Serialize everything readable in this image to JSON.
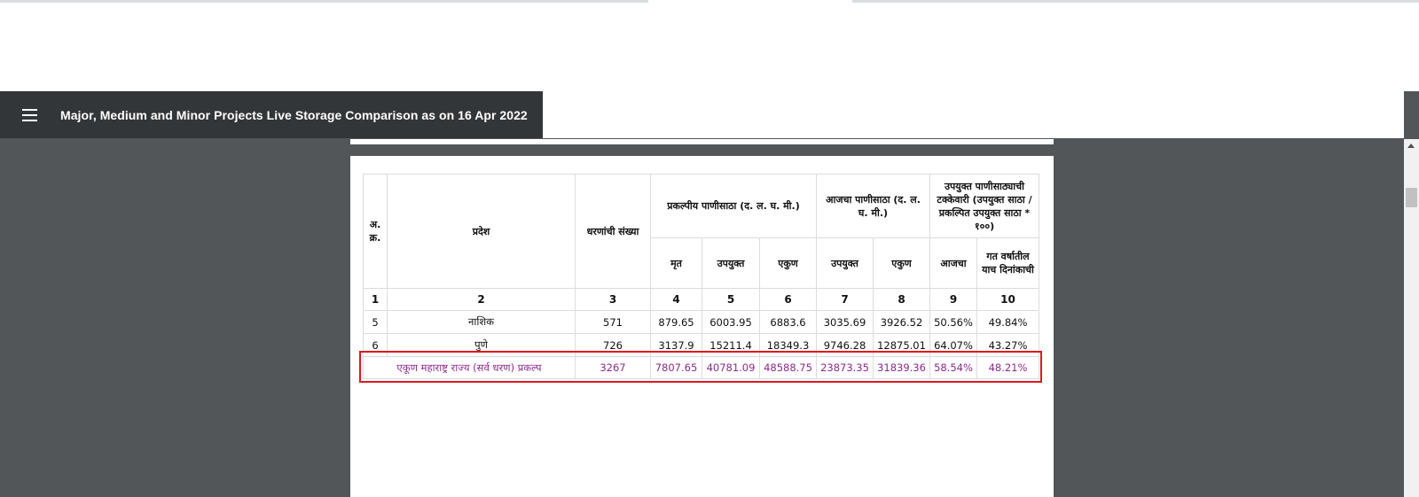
{
  "toolbar": {
    "title": "Major, Medium and Minor Projects Live Storage Comparison as on 16 Apr 2022",
    "menu_icon": "hamburger-menu-icon"
  },
  "table": {
    "headers": {
      "sr_no": "अ. क्र.",
      "region": "प्रदेश",
      "dam_count": "धरणांची संख्या",
      "project_storage": "प्रकल्पीय पाणीसाठा (द. ल. घ. मी.)",
      "today_storage": "आजचा पाणीसाठा (द. ल. घ. मी.)",
      "percentage": "उपयुक्त पाणीसाठ्याची टक्केवारी (उपयुक्त साठा / प्रकल्पित उपयुक्त साठा * १००)",
      "dead": "मृत",
      "useful": "उपयुक्त",
      "total": "एकुण",
      "useful_today": "उपयुक्त",
      "total_today": "एकुण",
      "today": "आजचा",
      "last_year": "गत वर्षातील याच दिनांकाची"
    },
    "column_numbers": [
      "1",
      "2",
      "3",
      "4",
      "5",
      "6",
      "7",
      "8",
      "9",
      "10"
    ],
    "rows": [
      [
        "5",
        "नाशिक",
        "571",
        "879.65",
        "6003.95",
        "6883.6",
        "3035.69",
        "3926.52",
        "50.56%",
        "49.84%"
      ],
      [
        "6",
        "पुणे",
        "726",
        "3137.9",
        "15211.4",
        "18349.3",
        "9746.28",
        "12875.01",
        "64.07%",
        "43.27%"
      ]
    ],
    "total_row": {
      "label": "एकूण महाराष्ट्र राज्य (सर्व धरण) प्रकल्प",
      "values": [
        "3267",
        "7807.65",
        "40781.09",
        "48588.75",
        "23873.35",
        "31839.36",
        "58.54%",
        "48.21%"
      ]
    }
  },
  "colors": {
    "toolbar_bg": "#323639",
    "viewer_bg": "#525659",
    "total_row_text": "#8e2a8e",
    "highlight_border": "#e0161e"
  }
}
